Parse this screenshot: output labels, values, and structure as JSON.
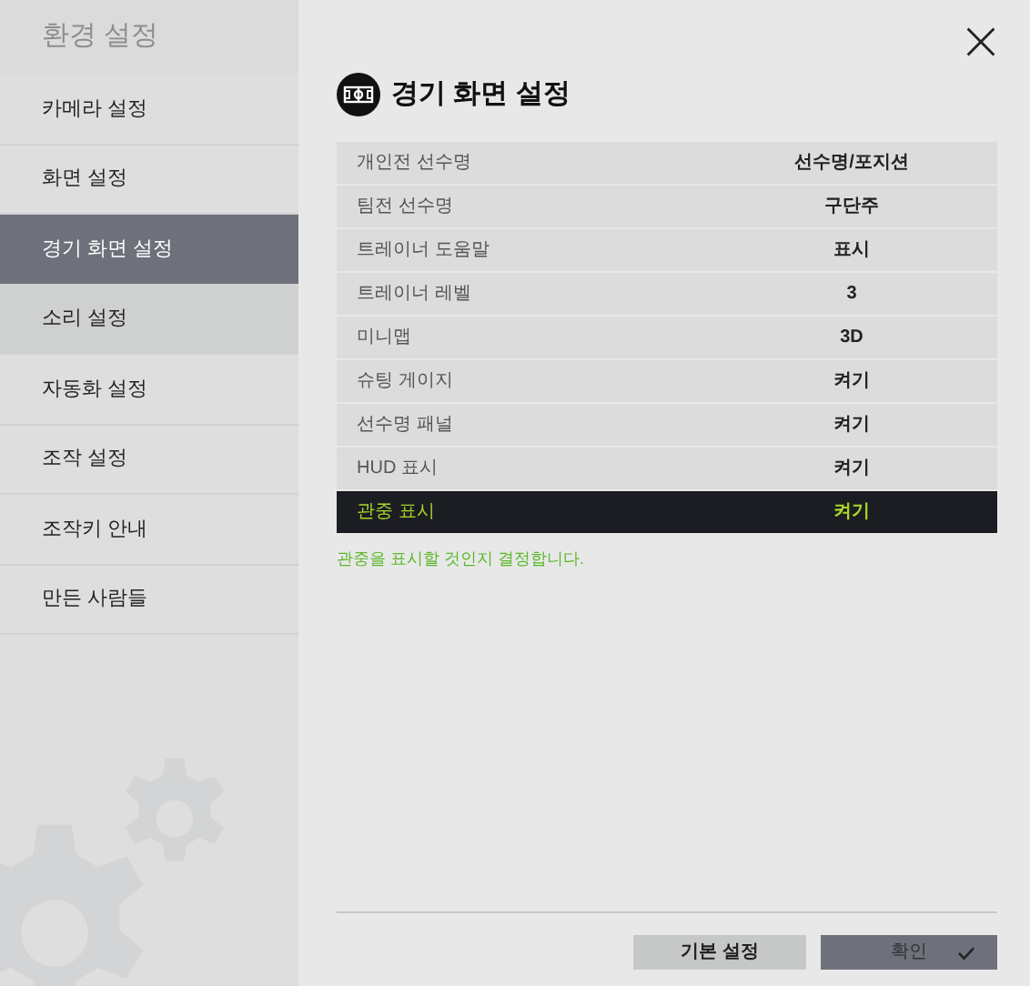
{
  "sidebar": {
    "title": "환경 설정",
    "items": [
      {
        "label": "카메라 설정",
        "selected": false,
        "hovered": false
      },
      {
        "label": "화면 설정",
        "selected": false,
        "hovered": false
      },
      {
        "label": "경기 화면 설정",
        "selected": true,
        "hovered": false
      },
      {
        "label": "소리 설정",
        "selected": false,
        "hovered": true
      },
      {
        "label": "자동화 설정",
        "selected": false,
        "hovered": false
      },
      {
        "label": "조작 설정",
        "selected": false,
        "hovered": false
      },
      {
        "label": "조작키 안내",
        "selected": false,
        "hovered": false
      },
      {
        "label": "만든 사람들",
        "selected": false,
        "hovered": false
      }
    ]
  },
  "panel": {
    "title": "경기 화면 설정",
    "settings": [
      {
        "name": "개인전 선수명",
        "value": "선수명/포지션",
        "selected": false
      },
      {
        "name": "팀전 선수명",
        "value": "구단주",
        "selected": false
      },
      {
        "name": "트레이너 도움말",
        "value": "표시",
        "selected": false
      },
      {
        "name": "트레이너 레벨",
        "value": "3",
        "selected": false
      },
      {
        "name": "미니맵",
        "value": "3D",
        "selected": false
      },
      {
        "name": "슈팅 게이지",
        "value": "켜기",
        "selected": false
      },
      {
        "name": "선수명 패널",
        "value": "켜기",
        "selected": false
      },
      {
        "name": "HUD 표시",
        "value": "켜기",
        "selected": false
      },
      {
        "name": "관중 표시",
        "value": "켜기",
        "selected": true
      }
    ],
    "description": "관중을 표시할 것인지 결정합니다."
  },
  "buttons": {
    "reset": "기본 설정",
    "confirm": "확인"
  }
}
